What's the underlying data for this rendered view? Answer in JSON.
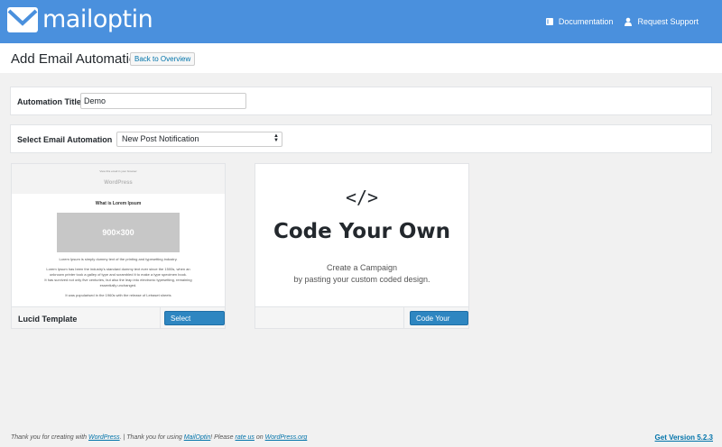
{
  "brand": {
    "name": "mailoptin"
  },
  "top_links": {
    "documentation": "Documentation",
    "support": "Request Support"
  },
  "header": {
    "title": "Add Email Automation",
    "back_label": "Back to Overview"
  },
  "form": {
    "title_label": "Automation Title",
    "title_value": "Demo",
    "type_label": "Select Email Automation",
    "type_value": "New Post Notification"
  },
  "templates": {
    "lucid": {
      "preview_small": "View this email in your browser",
      "preview_site": "WordPress",
      "preview_heading": "What is Lorem Ipsum",
      "preview_image": "900×300",
      "preview_p1": "Lorem Ipsum is simply dummy text of the printing and typesetting industry.",
      "preview_p2": "Lorem Ipsum has been the industry's standard dummy text ever since the 1500s, when an unknown printer took a galley of type and scrambled it to make a type specimen book.",
      "preview_p3": "It has survived not only five centuries, but also the leap into electronic typesetting, remaining essentially unchanged.",
      "preview_p4": "It was popularised in the 1960s with the release of Letraset sheets",
      "name": "Lucid Template",
      "button": "Select Template"
    },
    "code": {
      "icon_text": "</>",
      "title": "Code Your Own",
      "sub1": "Create a Campaign",
      "sub2": "by pasting your custom coded design.",
      "button": "Code Your Own"
    }
  },
  "footer": {
    "t1": "Thank you for creating with ",
    "wordpress": "WordPress",
    "t2": ". | Thank you for using ",
    "mailoptin": "MailOptin",
    "t3": "! Please ",
    "rate": "rate us",
    "t4": " on ",
    "wporg": "WordPress.org",
    "version": "Get Version 5.2.3"
  },
  "colors": {
    "topbar": "#4a90dd",
    "primary_button": "#2e86c1",
    "link": "#0073aa"
  },
  "icons": {
    "logo": "envelope-icon",
    "documentation": "book-icon",
    "support": "user-icon",
    "select": "chevron-down-icon"
  }
}
